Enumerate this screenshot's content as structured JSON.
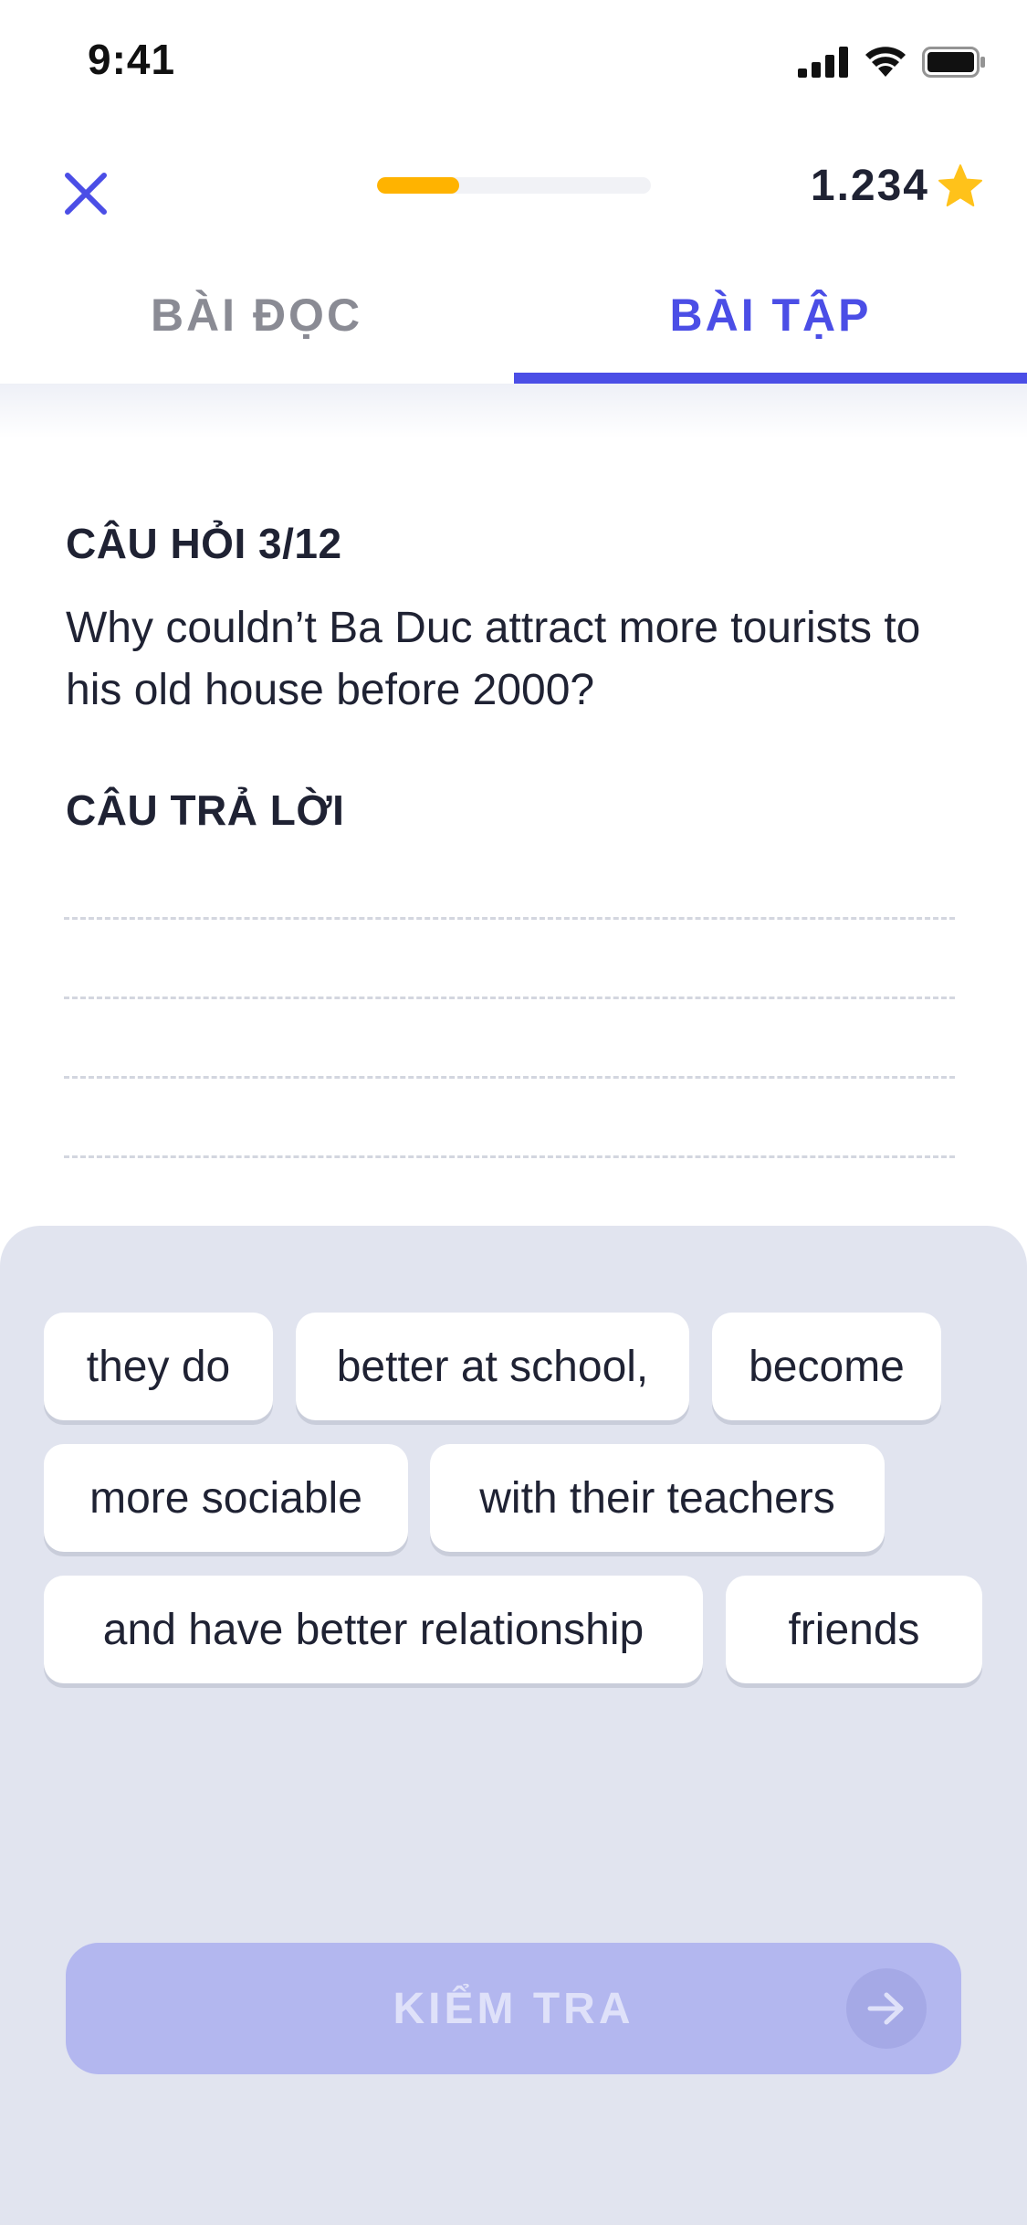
{
  "status_bar": {
    "time": "9:41",
    "icons": [
      "signal-icon",
      "wifi-icon",
      "battery-icon"
    ]
  },
  "header": {
    "close_icon": "close-icon",
    "progress_fraction": 0.3,
    "score": "1.234",
    "score_icon": "star-icon"
  },
  "tabs": [
    {
      "label": "BÀI ĐỌC",
      "active": false
    },
    {
      "label": "BÀI TẬP",
      "active": true
    }
  ],
  "question": {
    "label": "CÂU HỎI 3/12",
    "text": "Why couldn’t Ba Duc attract more tourists to his old house before 2000?"
  },
  "answer": {
    "label": "CÂU TRẢ LỜI"
  },
  "word_bank": [
    {
      "text": "they do"
    },
    {
      "text": "better at school,"
    },
    {
      "text": "become"
    },
    {
      "text": "more sociable"
    },
    {
      "text": "with their teachers"
    },
    {
      "text": "and have better relationship"
    },
    {
      "text": "friends"
    }
  ],
  "check_button": {
    "label": "KIỂM TRA",
    "icon": "arrow-right-icon"
  },
  "colors": {
    "accent": "#4b4ee6",
    "progress": "#ffb300",
    "star": "#ffc21a",
    "bank_background": "#e1e4ef",
    "button_disabled": "#b3b7ef"
  }
}
